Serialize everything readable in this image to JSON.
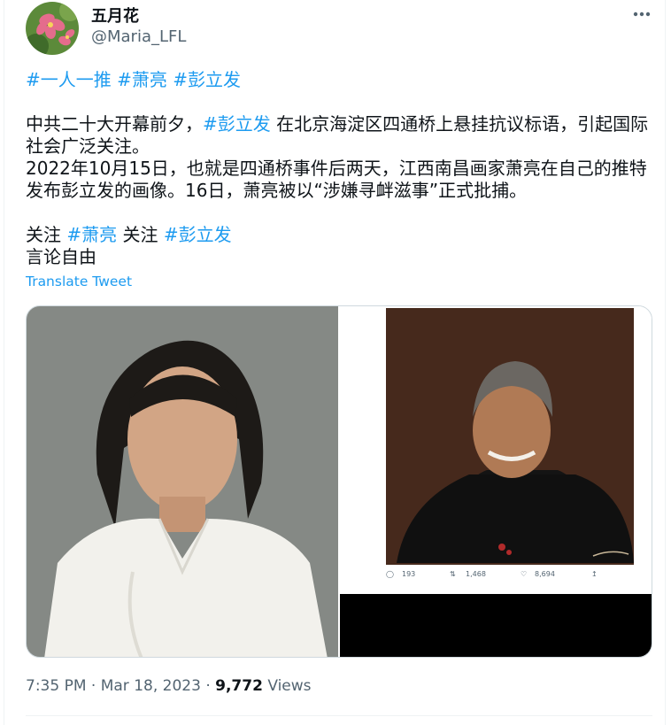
{
  "author": {
    "display_name": "五月花",
    "handle": "@Maria_LFL"
  },
  "tweet": {
    "hashtags_line": [
      "#一人一推",
      "#萧亮",
      "#彭立发"
    ],
    "paragraph1_before": "中共二十大开幕前夕，",
    "paragraph1_tag": "#彭立发",
    "paragraph1_after": " 在北京海淀区四通桥上悬挂抗议标语，引起国际社会广泛关注。",
    "paragraph2": "2022年10月15日，也就是四通桥事件后两天，江西南昌画家萧亮在自己的推特发布彭立发的画像。16日，萧亮被以“涉嫌寻衅滋事”正式批捕。",
    "follow_label": "关注",
    "follow_tag1": "#萧亮",
    "follow_tag2": "#彭立发",
    "last_line": "言论自由",
    "translate_label": "Translate Tweet"
  },
  "embedded_screenshot": {
    "reply_count": "193",
    "retweet_count": "1,468",
    "like_count": "8,694"
  },
  "meta": {
    "time": "7:35 PM",
    "date": "Mar 18, 2023",
    "views_count": "9,772",
    "views_label": "Views"
  },
  "colors": {
    "accent": "#1d9bf0",
    "secondary_text": "#536471",
    "border": "#cfd9de"
  },
  "icons": [
    "more-options-icon",
    "reply-icon",
    "retweet-icon",
    "like-icon",
    "share-icon"
  ]
}
